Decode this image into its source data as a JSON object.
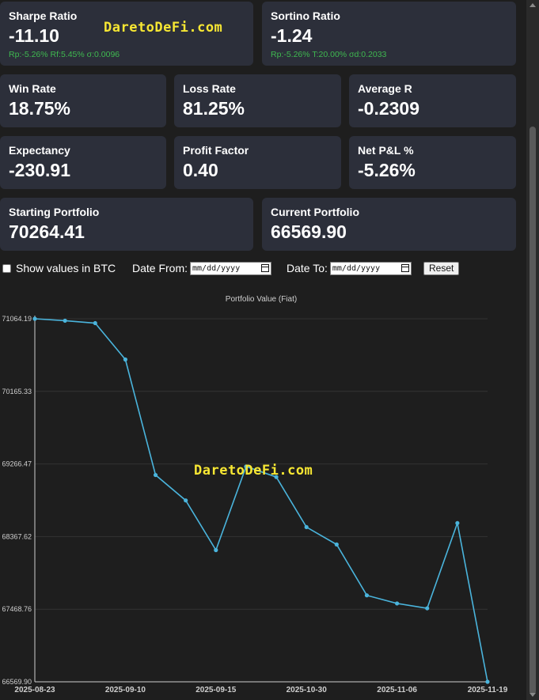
{
  "watermark": "DaretoDeFi.com",
  "cards": {
    "sharpe": {
      "label": "Sharpe Ratio",
      "value": "-11.10",
      "sub": "Rp:-5.26% Rf:5.45% σ:0.0096"
    },
    "sortino": {
      "label": "Sortino Ratio",
      "value": "-1.24",
      "sub": "Rp:-5.26% T:20.00% σd:0.2033"
    },
    "win_rate": {
      "label": "Win Rate",
      "value": "18.75%"
    },
    "loss_rate": {
      "label": "Loss Rate",
      "value": "81.25%"
    },
    "average_r": {
      "label": "Average R",
      "value": "-0.2309"
    },
    "expectancy": {
      "label": "Expectancy",
      "value": "-230.91"
    },
    "profit_factor": {
      "label": "Profit Factor",
      "value": "0.40"
    },
    "net_pnl": {
      "label": "Net P&L %",
      "value": "-5.26%"
    },
    "starting_portfolio": {
      "label": "Starting Portfolio",
      "value": "70264.41"
    },
    "current_portfolio": {
      "label": "Current Portfolio",
      "value": "66569.90"
    }
  },
  "controls": {
    "show_btc_label": "Show values in BTC",
    "show_btc_checked": false,
    "date_from_label": "Date From:",
    "date_to_label": "Date To:",
    "date_placeholder": "mm/dd/yyyy",
    "reset_label": "Reset"
  },
  "colors": {
    "background": "#1e1e1e",
    "card": "#2c2f3a",
    "positive_sub": "#3fb950",
    "line": "#4ab4dc",
    "watermark": "#f7e733"
  },
  "chart_data": {
    "type": "line",
    "title": "Portfolio Value (Fiat)",
    "xlabel": "",
    "ylabel": "",
    "x_tick_labels": [
      "2025-08-23",
      "2025-09-10",
      "2025-09-15",
      "2025-10-30",
      "2025-11-06",
      "2025-11-19"
    ],
    "y_tick_labels": [
      "71064.19",
      "70165.33",
      "69266.47",
      "68367.62",
      "67468.76",
      "66569.90"
    ],
    "ylim": [
      66569.9,
      71064.19
    ],
    "grid": true,
    "series": [
      {
        "values": [
          71064.19,
          71040,
          71010,
          70560,
          69130,
          68815,
          68200,
          69235,
          69105,
          68485,
          68270,
          67640,
          67540,
          67480,
          68535,
          66569.9
        ]
      }
    ]
  }
}
